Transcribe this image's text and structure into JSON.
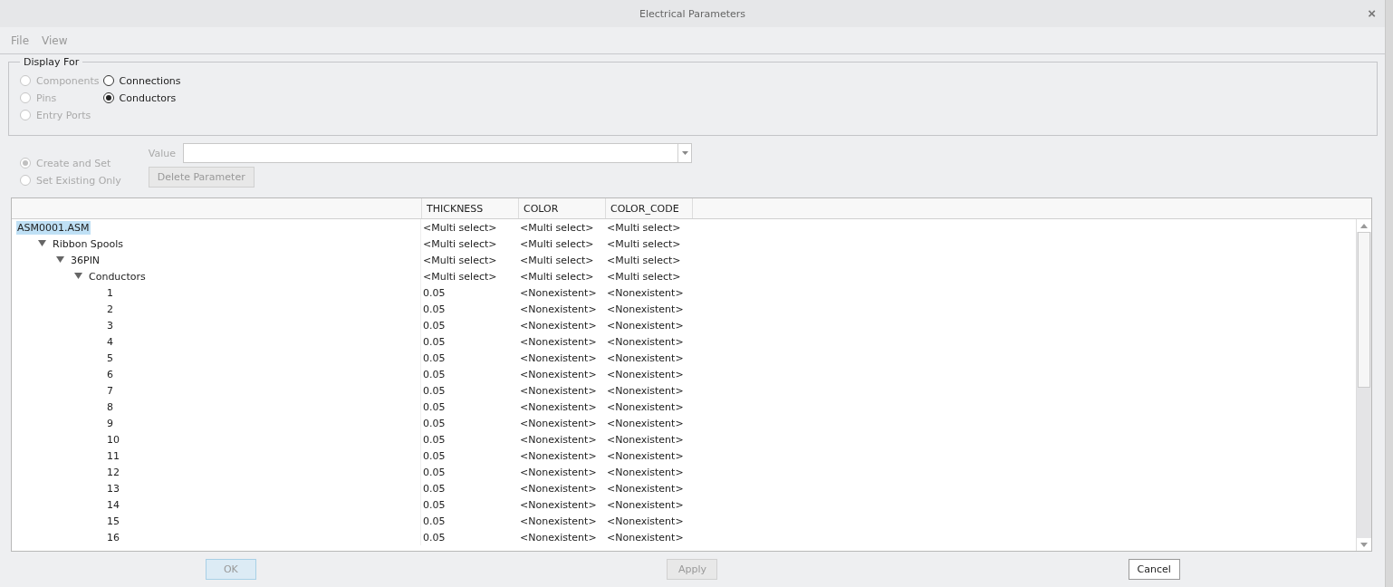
{
  "window": {
    "title": "Electrical Parameters",
    "close": "×"
  },
  "menu": [
    "File",
    "View"
  ],
  "display_for": {
    "title": "Display For",
    "columns": [
      [
        {
          "label": "Components",
          "selected": false,
          "disabled": true
        },
        {
          "label": "Pins",
          "selected": false,
          "disabled": true
        },
        {
          "label": "Entry Ports",
          "selected": false,
          "disabled": true
        }
      ],
      [
        {
          "label": "Connections",
          "selected": false,
          "disabled": false
        },
        {
          "label": "Conductors",
          "selected": true,
          "disabled": false
        }
      ]
    ]
  },
  "mode": [
    {
      "label": "Create and Set",
      "selected": true,
      "disabled": true
    },
    {
      "label": "Set Existing Only",
      "selected": false,
      "disabled": true
    }
  ],
  "value": {
    "label": "Value"
  },
  "delete_button": {
    "label": "Delete Parameter",
    "disabled": true
  },
  "table": {
    "columns": [
      "THICKNESS",
      "COLOR",
      "COLOR_CODE"
    ],
    "rows": [
      {
        "name": "ASM0001.ASM",
        "selected": true,
        "cells": [
          "<Multi select>",
          "<Multi select>",
          "<Multi select>"
        ],
        "children": [
          {
            "name": "Ribbon Spools",
            "selected": false,
            "expanded": true,
            "cells": [
              "<Multi select>",
              "<Multi select>",
              "<Multi select>"
            ],
            "children": [
              {
                "name": "36PIN",
                "selected": false,
                "expanded": true,
                "cells": [
                  "<Multi select>",
                  "<Multi select>",
                  "<Multi select>"
                ],
                "children": [
                  {
                    "name": "Conductors",
                    "selected": false,
                    "expanded": true,
                    "cells": [
                      "<Multi select>",
                      "<Multi select>",
                      "<Multi select>"
                    ],
                    "children": [
                      {
                        "name": "1",
                        "selected": false,
                        "cells": [
                          "0.05",
                          "<Nonexistent>",
                          "<Nonexistent>"
                        ]
                      },
                      {
                        "name": "2",
                        "selected": false,
                        "cells": [
                          "0.05",
                          "<Nonexistent>",
                          "<Nonexistent>"
                        ]
                      },
                      {
                        "name": "3",
                        "selected": false,
                        "cells": [
                          "0.05",
                          "<Nonexistent>",
                          "<Nonexistent>"
                        ]
                      },
                      {
                        "name": "4",
                        "selected": false,
                        "cells": [
                          "0.05",
                          "<Nonexistent>",
                          "<Nonexistent>"
                        ]
                      },
                      {
                        "name": "5",
                        "selected": false,
                        "cells": [
                          "0.05",
                          "<Nonexistent>",
                          "<Nonexistent>"
                        ]
                      },
                      {
                        "name": "6",
                        "selected": false,
                        "cells": [
                          "0.05",
                          "<Nonexistent>",
                          "<Nonexistent>"
                        ]
                      },
                      {
                        "name": "7",
                        "selected": false,
                        "cells": [
                          "0.05",
                          "<Nonexistent>",
                          "<Nonexistent>"
                        ]
                      },
                      {
                        "name": "8",
                        "selected": false,
                        "cells": [
                          "0.05",
                          "<Nonexistent>",
                          "<Nonexistent>"
                        ]
                      },
                      {
                        "name": "9",
                        "selected": false,
                        "cells": [
                          "0.05",
                          "<Nonexistent>",
                          "<Nonexistent>"
                        ]
                      },
                      {
                        "name": "10",
                        "selected": false,
                        "cells": [
                          "0.05",
                          "<Nonexistent>",
                          "<Nonexistent>"
                        ]
                      },
                      {
                        "name": "11",
                        "selected": false,
                        "cells": [
                          "0.05",
                          "<Nonexistent>",
                          "<Nonexistent>"
                        ]
                      },
                      {
                        "name": "12",
                        "selected": false,
                        "cells": [
                          "0.05",
                          "<Nonexistent>",
                          "<Nonexistent>"
                        ]
                      },
                      {
                        "name": "13",
                        "selected": false,
                        "cells": [
                          "0.05",
                          "<Nonexistent>",
                          "<Nonexistent>"
                        ]
                      },
                      {
                        "name": "14",
                        "selected": false,
                        "cells": [
                          "0.05",
                          "<Nonexistent>",
                          "<Nonexistent>"
                        ]
                      },
                      {
                        "name": "15",
                        "selected": false,
                        "cells": [
                          "0.05",
                          "<Nonexistent>",
                          "<Nonexistent>"
                        ]
                      },
                      {
                        "name": "16",
                        "selected": false,
                        "cells": [
                          "0.05",
                          "<Nonexistent>",
                          "<Nonexistent>"
                        ]
                      }
                    ]
                  }
                ]
              }
            ]
          }
        ]
      }
    ]
  },
  "buttons": [
    {
      "label": "OK",
      "disabled": true,
      "default": true
    },
    {
      "label": "Apply",
      "disabled": true,
      "default": false
    },
    {
      "label": "Cancel",
      "disabled": false,
      "default": false
    }
  ]
}
